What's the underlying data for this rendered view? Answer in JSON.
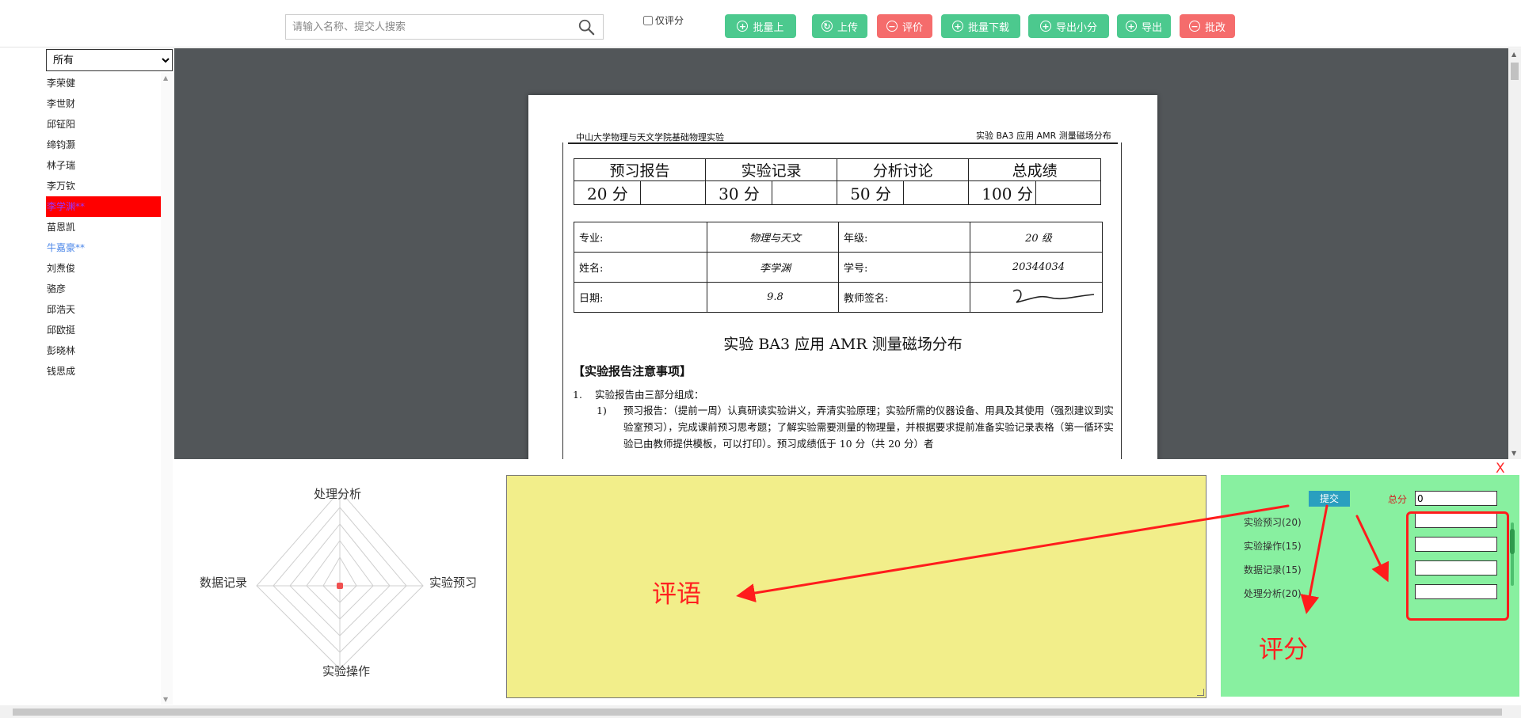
{
  "toolbar": {
    "search_placeholder": "请输入名称、提交人搜索",
    "only_score_label": "仅评分",
    "buttons": [
      {
        "label": "批量上",
        "icon": "plus-circle-icon",
        "glyph": "+",
        "color": "#4cc98e"
      },
      {
        "label": "上传",
        "icon": "refresh-circle-icon",
        "glyph": "↻",
        "color": "#4cc98e"
      },
      {
        "label": "评价",
        "icon": "minus-circle-icon",
        "glyph": "−",
        "color": "#f56c6c"
      },
      {
        "label": "批量下载",
        "icon": "plus-circle-icon",
        "glyph": "+",
        "color": "#4cc98e"
      },
      {
        "label": "导出小分",
        "icon": "plus-circle-icon",
        "glyph": "+",
        "color": "#4cc98e"
      },
      {
        "label": "导出",
        "icon": "plus-circle-icon",
        "glyph": "+",
        "color": "#4cc98e"
      },
      {
        "label": "批改",
        "icon": "minus-circle-icon",
        "glyph": "−",
        "color": "#f56c6c"
      }
    ]
  },
  "sidebar": {
    "filter_value": "所有",
    "students": [
      {
        "name": "李荣健",
        "state": "normal"
      },
      {
        "name": "李世财",
        "state": "normal"
      },
      {
        "name": "邱钲阳",
        "state": "normal"
      },
      {
        "name": "缔钧灏",
        "state": "normal"
      },
      {
        "name": "林子瑞",
        "state": "normal"
      },
      {
        "name": "李万钦",
        "state": "normal"
      },
      {
        "name": "李学渊**",
        "state": "active"
      },
      {
        "name": "苗恩凯",
        "state": "normal"
      },
      {
        "name": "牛嘉豪**",
        "state": "graded"
      },
      {
        "name": "刘焘俊",
        "state": "normal"
      },
      {
        "name": "骆彦",
        "state": "normal"
      },
      {
        "name": "邱浩天",
        "state": "normal"
      },
      {
        "name": "邱欧挺",
        "state": "normal"
      },
      {
        "name": "彭晓林",
        "state": "normal"
      },
      {
        "name": "钱思成",
        "state": "normal"
      }
    ]
  },
  "document": {
    "header_left": "中山大学物理与天文学院基础物理实验",
    "header_right": "实验 BA3 应用 AMR 测量磁场分布",
    "score_table": {
      "headers": [
        "预习报告",
        "实验记录",
        "分析讨论",
        "总成绩"
      ],
      "values": [
        "20 分",
        "30 分",
        "50 分",
        "100 分"
      ]
    },
    "info": {
      "major_label": "专业:",
      "major_value": "物理与天文",
      "grade_label": "年级:",
      "grade_value": "20 级",
      "name_label": "姓名:",
      "name_value": "李学渊",
      "id_label": "学号:",
      "id_value": "20344034",
      "date_label": "日期:",
      "date_value": "9.8",
      "teacher_label": "教师签名:"
    },
    "title": "实验 BA3 应用 AMR 测量磁场分布",
    "section": "【实验报告注意事项】",
    "item1_num": "1.",
    "item1_text": "实验报告由三部分组成：",
    "para_num": "1)",
    "para_text": "预习报告：（提前一周）认真研读实验讲义，弄清实验原理；实验所需的仪器设备、用具及其使用（强烈建议到实验室预习），完成课前预习思考题；了解实验需要测量的物理量，并根据要求提前准备实验记录表格（第一循环实验已由教师提供模板，可以打印）。预习成绩低于 10 分（共 20 分）者"
  },
  "radar": {
    "labels": {
      "top": "处理分析",
      "right": "实验预习",
      "bottom": "实验操作",
      "left": "数据记录"
    },
    "values": {
      "处理分析": 0,
      "实验预习": 0,
      "实验操作": 0,
      "数据记录": 0
    }
  },
  "comment": {
    "value": ""
  },
  "scoring": {
    "submit_label": "提交",
    "total_label": "总分",
    "total_value": "0",
    "criteria": [
      {
        "label": "实验预习(20)",
        "value": ""
      },
      {
        "label": "实验操作(15)",
        "value": ""
      },
      {
        "label": "数据记录(15)",
        "value": ""
      },
      {
        "label": "处理分析(20)",
        "value": ""
      }
    ],
    "close_label": "X"
  },
  "annotations": {
    "comment_label": "评语",
    "score_label": "评分",
    "color": "#ff2020"
  }
}
